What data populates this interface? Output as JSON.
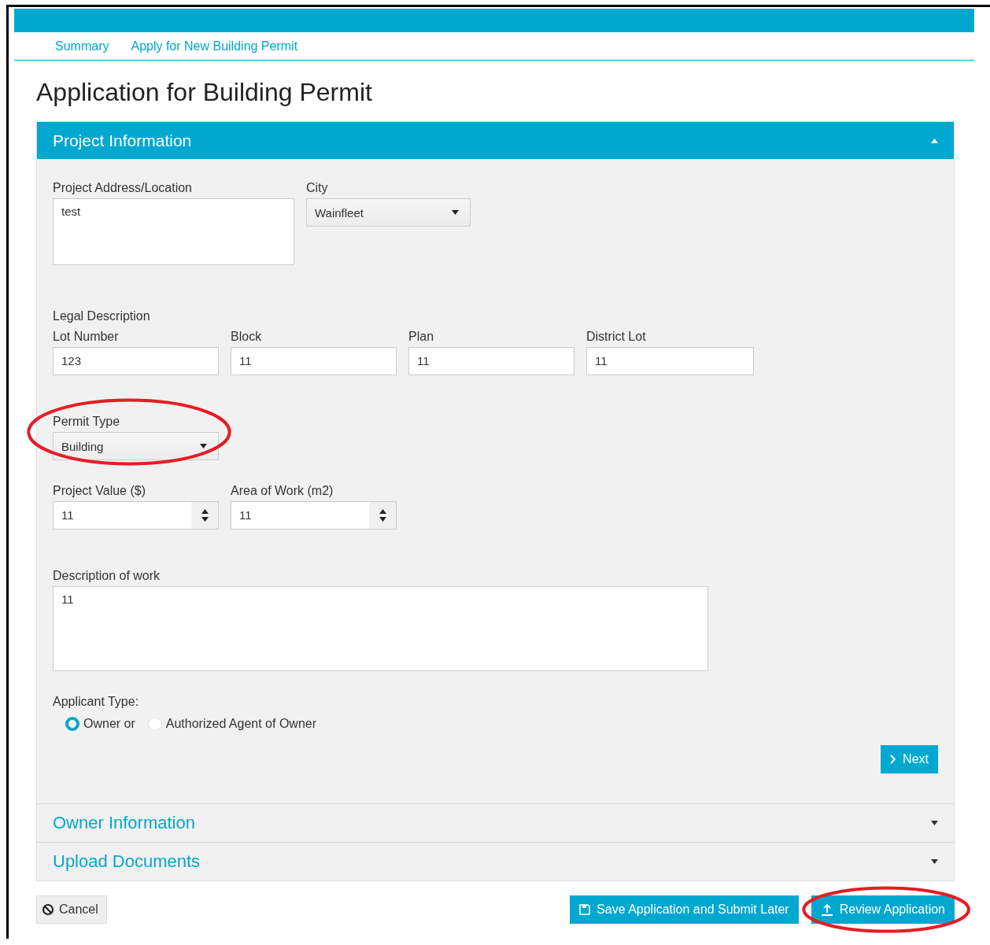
{
  "breadcrumbs": [
    {
      "label": "Summary"
    },
    {
      "label": "Apply for New Building Permit"
    }
  ],
  "title": "Application for Building Permit",
  "sections": [
    {
      "title": "Project Information",
      "expanded": true
    },
    {
      "title": "Owner Information",
      "expanded": false
    },
    {
      "title": "Upload Documents",
      "expanded": false
    }
  ],
  "project": {
    "address": {
      "label": "Project Address/Location",
      "value": "test"
    },
    "city": {
      "label": "City",
      "value": "Wainfleet"
    },
    "legal_heading": "Legal Description",
    "legal_fields": [
      {
        "label": "Lot Number",
        "value": "123"
      },
      {
        "label": "Block",
        "value": "11"
      },
      {
        "label": "Plan",
        "value": "11"
      },
      {
        "label": "District Lot",
        "value": "11"
      }
    ],
    "permit_type": {
      "label": "Permit Type",
      "value": "Building",
      "highlighted": true
    },
    "number_fields": [
      {
        "label": "Project Value ($)",
        "value": "11"
      },
      {
        "label": "Area of Work (m2)",
        "value": "11"
      }
    ],
    "description": {
      "label": "Description of work",
      "value": "11"
    },
    "applicant_type": {
      "label": "Applicant Type:",
      "options": [
        {
          "label": "Owner or",
          "selected": true
        },
        {
          "label": "Authorized Agent of Owner",
          "selected": false
        }
      ]
    },
    "next_button": "Next"
  },
  "actions": [
    {
      "kind": "cancel",
      "label": "Cancel"
    },
    {
      "kind": "save",
      "label": "Save Application and Submit Later"
    },
    {
      "kind": "review",
      "label": "Review Application",
      "highlighted": true
    }
  ]
}
